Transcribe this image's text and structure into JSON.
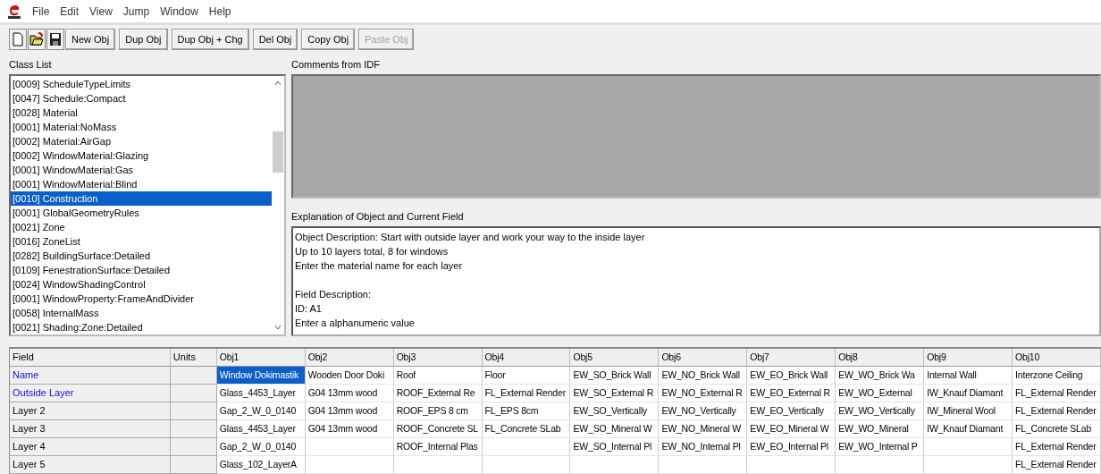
{
  "menu": [
    "File",
    "Edit",
    "View",
    "Jump",
    "Window",
    "Help"
  ],
  "toolbar": {
    "icon_buttons": [
      {
        "kind": "new"
      },
      {
        "kind": "open"
      },
      {
        "kind": "save"
      }
    ],
    "buttons": [
      {
        "label": "New Obj",
        "disabled": false
      },
      {
        "label": "Dup Obj",
        "disabled": false
      },
      {
        "label": "Dup Obj + Chg",
        "disabled": false
      },
      {
        "label": "Del Obj",
        "disabled": false
      },
      {
        "label": "Copy Obj",
        "disabled": false
      },
      {
        "label": "Paste Obj",
        "disabled": true
      }
    ]
  },
  "class_list": {
    "title": "Class List",
    "items": [
      {
        "label": "[0009]  ScheduleTypeLimits",
        "selected": false
      },
      {
        "label": "[0047]  Schedule:Compact",
        "selected": false
      },
      {
        "label": "[0028]  Material",
        "selected": false
      },
      {
        "label": "[0001]  Material:NoMass",
        "selected": false
      },
      {
        "label": "[0002]  Material:AirGap",
        "selected": false
      },
      {
        "label": "[0002]  WindowMaterial:Glazing",
        "selected": false
      },
      {
        "label": "[0001]  WindowMaterial:Gas",
        "selected": false
      },
      {
        "label": "[0001]  WindowMaterial:Blind",
        "selected": false
      },
      {
        "label": "[0010]  Construction",
        "selected": true
      },
      {
        "label": "[0001]  GlobalGeometryRules",
        "selected": false
      },
      {
        "label": "[0021]  Zone",
        "selected": false
      },
      {
        "label": "[0016]  ZoneList",
        "selected": false
      },
      {
        "label": "[0282]  BuildingSurface:Detailed",
        "selected": false
      },
      {
        "label": "[0109]  FenestrationSurface:Detailed",
        "selected": false
      },
      {
        "label": "[0024]  WindowShadingControl",
        "selected": false
      },
      {
        "label": "[0001]  WindowProperty:FrameAndDivider",
        "selected": false
      },
      {
        "label": "[0058]  InternalMass",
        "selected": false
      },
      {
        "label": "[0021]  Shading:Zone:Detailed",
        "selected": false
      }
    ]
  },
  "comments": {
    "title": "Comments from IDF"
  },
  "explanation": {
    "title": "Explanation of Object and Current Field",
    "paragraphs": [
      [
        "Object Description: Start with outside layer and work your way to the inside layer",
        "Up to 10 layers total, 8 for windows",
        "Enter the material name for each layer"
      ],
      [
        "Field Description:",
        "ID: A1",
        "Enter a alphanumeric value"
      ]
    ]
  },
  "table": {
    "field_header": "Field",
    "units_header": "Units",
    "columns": [
      "Obj1",
      "Obj2",
      "Obj3",
      "Obj4",
      "Obj5",
      "Obj6",
      "Obj7",
      "Obj8",
      "Obj9",
      "Obj10"
    ],
    "rows": [
      {
        "field": "Name",
        "required": true,
        "cells": [
          {
            "text": "Window Dokimastik",
            "selected": true
          },
          {
            "text": "Wooden Door Doki",
            "selected": false
          },
          {
            "text": "Roof",
            "selected": false
          },
          {
            "text": "Floor",
            "selected": false
          },
          {
            "text": "EW_SO_Brick Wall",
            "selected": false
          },
          {
            "text": "EW_NO_Brick Wall",
            "selected": false
          },
          {
            "text": "EW_EO_Brick Wall",
            "selected": false
          },
          {
            "text": "EW_WO_Brick Wa",
            "selected": false
          },
          {
            "text": "Internal Wall",
            "selected": false
          },
          {
            "text": "Interzone Ceiling",
            "selected": false
          }
        ]
      },
      {
        "field": "Outside Layer",
        "required": true,
        "cells": [
          {
            "text": "Glass_4453_Layer",
            "selected": false
          },
          {
            "text": "G04 13mm wood",
            "selected": false
          },
          {
            "text": "ROOF_External Re",
            "selected": false
          },
          {
            "text": "FL_External Render",
            "selected": false
          },
          {
            "text": "EW_SO_External R",
            "selected": false
          },
          {
            "text": "EW_NO_External R",
            "selected": false
          },
          {
            "text": "EW_EO_External R",
            "selected": false
          },
          {
            "text": "EW_WO_External",
            "selected": false
          },
          {
            "text": "IW_Knauf Diamant",
            "selected": false
          },
          {
            "text": "FL_External Render",
            "selected": false
          }
        ]
      },
      {
        "field": "Layer 2",
        "required": false,
        "cells": [
          {
            "text": "Gap_2_W_0_0140",
            "selected": false
          },
          {
            "text": "G04 13mm wood",
            "selected": false
          },
          {
            "text": "ROOF_EPS 8 cm",
            "selected": false
          },
          {
            "text": "FL_EPS 8cm",
            "selected": false
          },
          {
            "text": "EW_SO_Vertically",
            "selected": false
          },
          {
            "text": "EW_NO_Vertically",
            "selected": false
          },
          {
            "text": "EW_EO_Vertically",
            "selected": false
          },
          {
            "text": "EW_WO_Vertically",
            "selected": false
          },
          {
            "text": "IW_Mineral Wool",
            "selected": false
          },
          {
            "text": "FL_External Render",
            "selected": false
          }
        ]
      },
      {
        "field": "Layer 3",
        "required": false,
        "cells": [
          {
            "text": "Glass_4453_Layer",
            "selected": false
          },
          {
            "text": "G04 13mm wood",
            "selected": false
          },
          {
            "text": "ROOF_Concrete SL",
            "selected": false
          },
          {
            "text": "FL_Concrete SLab",
            "selected": false
          },
          {
            "text": "EW_SO_Mineral W",
            "selected": false
          },
          {
            "text": "EW_NO_Mineral W",
            "selected": false
          },
          {
            "text": "EW_EO_Mineral W",
            "selected": false
          },
          {
            "text": "EW_WO_Mineral",
            "selected": false
          },
          {
            "text": "IW_Knauf Diamant",
            "selected": false
          },
          {
            "text": "FL_Concrete SLab",
            "selected": false
          }
        ]
      },
      {
        "field": "Layer 4",
        "required": false,
        "cells": [
          {
            "text": "Gap_2_W_0_0140",
            "selected": false
          },
          "",
          {
            "text": "ROOF_Internal Plas",
            "selected": false
          },
          "",
          {
            "text": "EW_SO_Internal Pl",
            "selected": false
          },
          {
            "text": "EW_NO_Internal Pl",
            "selected": false
          },
          {
            "text": "EW_EO_Internal Pl",
            "selected": false
          },
          {
            "text": "EW_WO_Internal P",
            "selected": false
          },
          "",
          {
            "text": "FL_External Render",
            "selected": false
          }
        ]
      },
      {
        "field": "Layer 5",
        "required": false,
        "cells": [
          {
            "text": "Glass_102_LayerA",
            "selected": false
          },
          "",
          "",
          "",
          "",
          "",
          "",
          "",
          "",
          {
            "text": "FL_External Render",
            "selected": false
          }
        ]
      }
    ]
  }
}
